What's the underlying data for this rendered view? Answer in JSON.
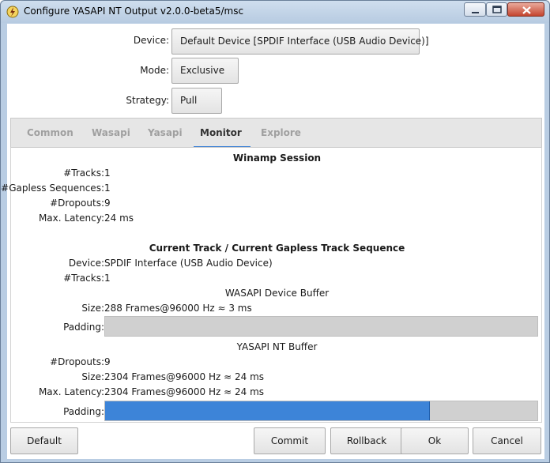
{
  "window": {
    "title": "Configure YASAPI NT Output v2.0.0-beta5/msc"
  },
  "settings": {
    "device_label": "Device:",
    "device_value": "Default Device [SPDIF Interface (USB Audio Device)]",
    "mode_label": "Mode:",
    "mode_value": "Exclusive",
    "strategy_label": "Strategy:",
    "strategy_value": "Pull"
  },
  "tabs": [
    {
      "label": "Common"
    },
    {
      "label": "Wasapi"
    },
    {
      "label": "Yasapi"
    },
    {
      "label": "Monitor"
    },
    {
      "label": "Explore"
    }
  ],
  "active_tab": "Monitor",
  "monitor": {
    "session_heading": "Winamp Session",
    "session": [
      {
        "label": "#Tracks:",
        "value": "1"
      },
      {
        "label": "#Gapless Sequences:",
        "value": "1"
      },
      {
        "label": "#Dropouts:",
        "value": "9"
      },
      {
        "label": "Max. Latency:",
        "value": "24 ms"
      }
    ],
    "track_heading": "Current Track / Current Gapless Track Sequence",
    "track": [
      {
        "label": "Device:",
        "value": "SPDIF Interface (USB Audio Device)"
      },
      {
        "label": "#Tracks:",
        "value": "1"
      }
    ],
    "wasapi_heading": "WASAPI Device Buffer",
    "wasapi_size_label": "Size:",
    "wasapi_size_value": "288 Frames@96000 Hz ≈ 3 ms",
    "wasapi_padding_label": "Padding:",
    "wasapi_padding_fraction": 0.0,
    "yasapi_heading": "YASAPI NT Buffer",
    "yasapi": [
      {
        "label": "#Dropouts:",
        "value": "9"
      },
      {
        "label": "Size:",
        "value": "2304 Frames@96000 Hz ≈ 24 ms"
      },
      {
        "label": "Max. Latency:",
        "value": "2304 Frames@96000 Hz ≈ 24 ms"
      }
    ],
    "yasapi_padding_label": "Padding:",
    "yasapi_padding_fraction": 0.751
  },
  "buttons": {
    "default": "Default",
    "commit": "Commit",
    "rollback": "Rollback",
    "ok": "Ok",
    "cancel": "Cancel"
  },
  "colors": {
    "accent": "#3d84d8",
    "tab_underline": "#3f83d6"
  }
}
